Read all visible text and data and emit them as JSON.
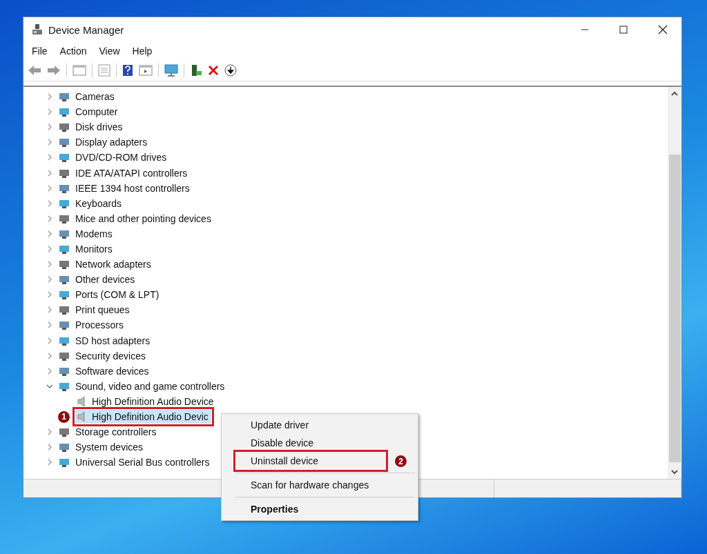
{
  "window": {
    "title": "Device Manager"
  },
  "menu": [
    "File",
    "Action",
    "View",
    "Help"
  ],
  "tree": [
    {
      "label": "Cameras",
      "expanded": false
    },
    {
      "label": "Computer",
      "expanded": false
    },
    {
      "label": "Disk drives",
      "expanded": false
    },
    {
      "label": "Display adapters",
      "expanded": false
    },
    {
      "label": "DVD/CD-ROM drives",
      "expanded": false
    },
    {
      "label": "IDE ATA/ATAPI controllers",
      "expanded": false
    },
    {
      "label": "IEEE 1394 host controllers",
      "expanded": false
    },
    {
      "label": "Keyboards",
      "expanded": false
    },
    {
      "label": "Mice and other pointing devices",
      "expanded": false
    },
    {
      "label": "Modems",
      "expanded": false
    },
    {
      "label": "Monitors",
      "expanded": false
    },
    {
      "label": "Network adapters",
      "expanded": false
    },
    {
      "label": "Other devices",
      "expanded": false
    },
    {
      "label": "Ports (COM & LPT)",
      "expanded": false
    },
    {
      "label": "Print queues",
      "expanded": false
    },
    {
      "label": "Processors",
      "expanded": false
    },
    {
      "label": "SD host adapters",
      "expanded": false
    },
    {
      "label": "Security devices",
      "expanded": false
    },
    {
      "label": "Software devices",
      "expanded": false
    },
    {
      "label": "Sound, video and game controllers",
      "expanded": true,
      "children": [
        {
          "label": "High Definition Audio Device",
          "selected": false
        },
        {
          "label": "High Definition Audio Devic",
          "selected": true,
          "annotation": "1"
        }
      ]
    },
    {
      "label": "Storage controllers",
      "expanded": false
    },
    {
      "label": "System devices",
      "expanded": false
    },
    {
      "label": "Universal Serial Bus controllers",
      "expanded": false
    }
  ],
  "context_menu": [
    {
      "label": "Update driver",
      "separator_before": false,
      "bold": false
    },
    {
      "label": "Disable device",
      "separator_before": false,
      "bold": false
    },
    {
      "label": "Uninstall device",
      "separator_before": false,
      "bold": false,
      "annotation": "2"
    },
    {
      "label": "Scan for hardware changes",
      "separator_before": true,
      "bold": false
    },
    {
      "label": "Properties",
      "separator_before": true,
      "bold": true
    }
  ]
}
